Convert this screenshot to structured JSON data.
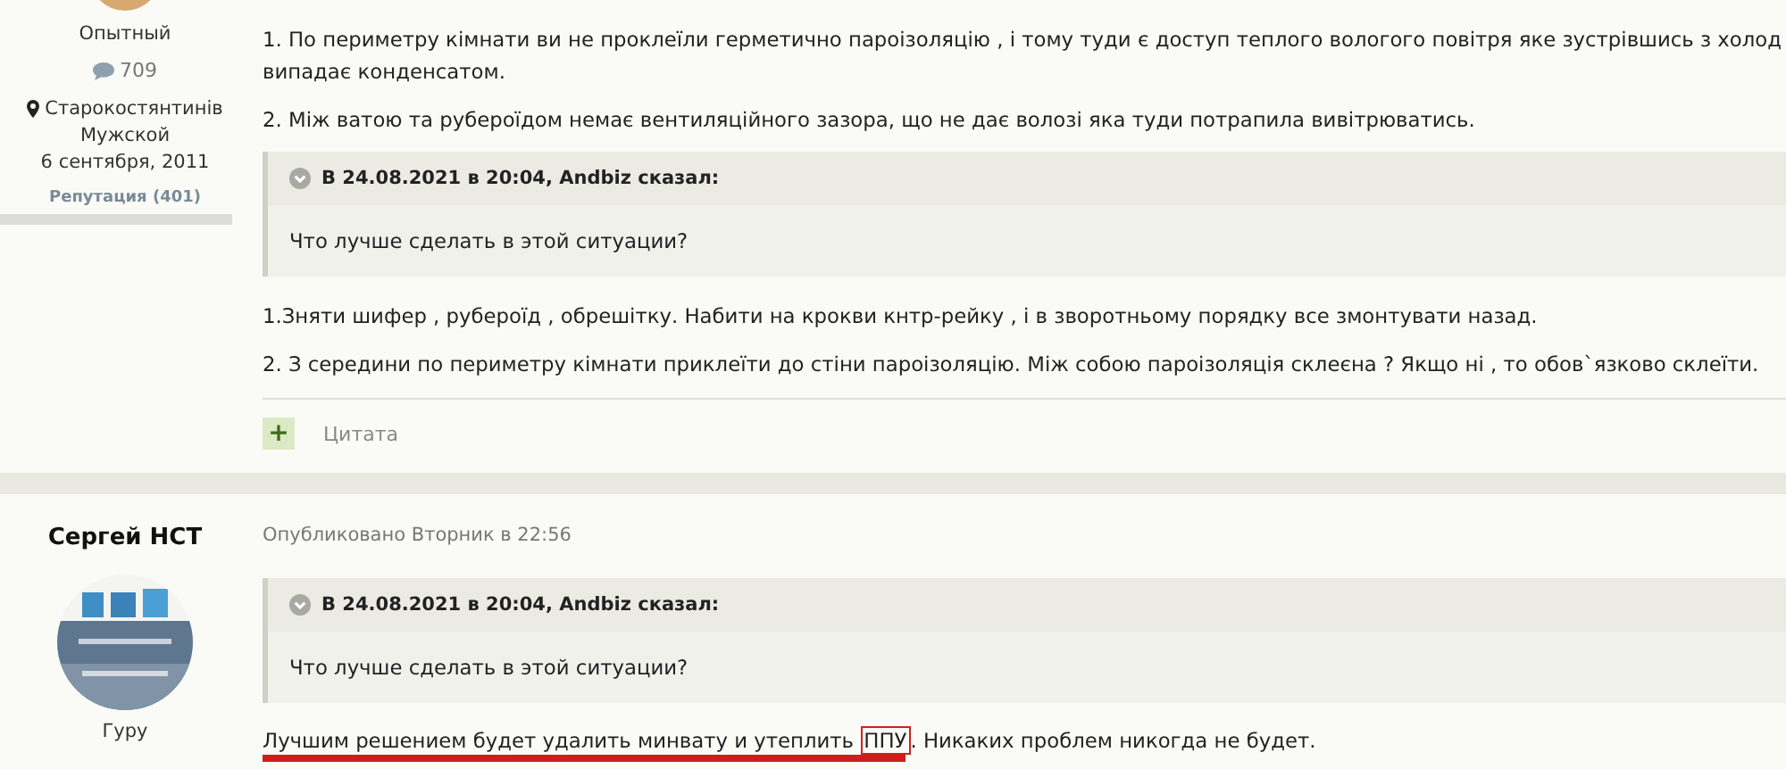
{
  "post_1": {
    "author": {
      "rank": "Опытный",
      "post_count": "709",
      "location": "Старокостянтинів",
      "gender": "Мужской",
      "joined": "6 сентября, 2011",
      "reputation": "Репутация (401)"
    },
    "body": [
      {
        "kind": "paragraph",
        "lines": [
          "1. По периметру кімнати ви не проклеїли герметично пароізоляцію , і тому туди є доступ теплого вологого повітря яке зустрівшись з холод",
          "випадає конденсатом."
        ]
      },
      {
        "kind": "paragraph",
        "lines": [
          "2. Між ватою та рубероїдом немає вентиляційного зазора, що не дає волозі яка туди потрапила вивітрюватись."
        ]
      },
      {
        "kind": "quote",
        "header": "В 24.08.2021 в 20:04, Andbiz сказал:",
        "text": "Что лучше сделать в этой ситуации?"
      },
      {
        "kind": "paragraph",
        "lines": [
          "1.Зняти шифер , рубероїд , обрешітку. Набити на крокви  кнтр-рейку , і в зворотньому порядку все змонтувати назад."
        ]
      },
      {
        "kind": "paragraph",
        "lines": [
          "2. З середини  по периметру кімнати приклеїти до стіни пароізоляцію. Між собою пароізоляція склеєна ? Якщо ні , то обов`язково склеїти."
        ]
      }
    ],
    "quote_button": {
      "icon": "+",
      "label": "Цитата"
    }
  },
  "post_2": {
    "author": {
      "name": "Сергей НСТ",
      "rank": "Гуру"
    },
    "published": "Опубликовано Вторник в 22:56",
    "body": [
      {
        "kind": "quote",
        "header": "В 24.08.2021 в 20:04, Andbiz сказал:",
        "text": "Что лучше сделать в этой ситуации?"
      },
      {
        "kind": "marked",
        "underlined": true,
        "segments": [
          {
            "text": "Лучшим решением будет удалить минвату и утеплить ",
            "boxed": false
          },
          {
            "text": "ППУ",
            "boxed": true
          },
          {
            "text": ". Никаких проблем никогда не будет.",
            "boxed": false
          }
        ]
      }
    ]
  }
}
